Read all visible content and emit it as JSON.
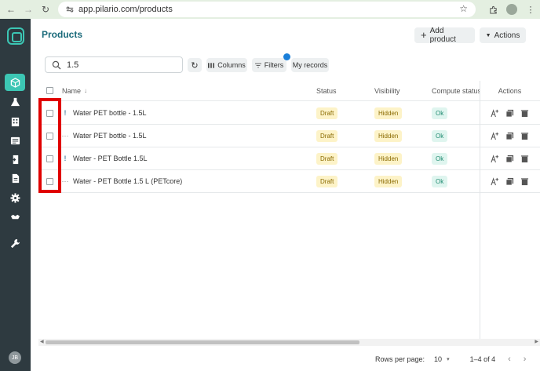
{
  "browser": {
    "url": "app.pilario.com/products"
  },
  "header": {
    "title": "Products",
    "add_label": "Add product",
    "actions_label": "Actions"
  },
  "toolbar": {
    "search_value": "1.5",
    "columns_label": "Columns",
    "filters_label": "Filters",
    "my_records_label": "My records"
  },
  "table": {
    "columns": {
      "name": "Name",
      "status": "Status",
      "visibility": "Visibility",
      "compute": "Compute status",
      "actions": "Actions"
    },
    "rows": [
      {
        "indicator": "!",
        "name": "Water PET bottle - 1.5L",
        "status": "Draft",
        "visibility": "Hidden",
        "compute": "Ok"
      },
      {
        "indicator": "···",
        "name": "Water PET bottle - 1.5L",
        "status": "Draft",
        "visibility": "Hidden",
        "compute": "Ok"
      },
      {
        "indicator": "!",
        "name": "Water - PET Bottle 1.5L",
        "status": "Draft",
        "visibility": "Hidden",
        "compute": "Ok"
      },
      {
        "indicator": "···",
        "name": "Water - PET Bottle 1.5 L (PETcore)",
        "status": "Draft",
        "visibility": "Hidden",
        "compute": "Ok"
      }
    ]
  },
  "footer": {
    "rows_per_page_label": "Rows per page:",
    "rows_per_page_value": "10",
    "range": "1–4 of 4"
  },
  "user": {
    "initials": "JB"
  },
  "colors": {
    "accent": "#3cc6b4",
    "title": "#1a6a7a",
    "sidebar": "#2e3a40",
    "highlight": "#e00000"
  }
}
